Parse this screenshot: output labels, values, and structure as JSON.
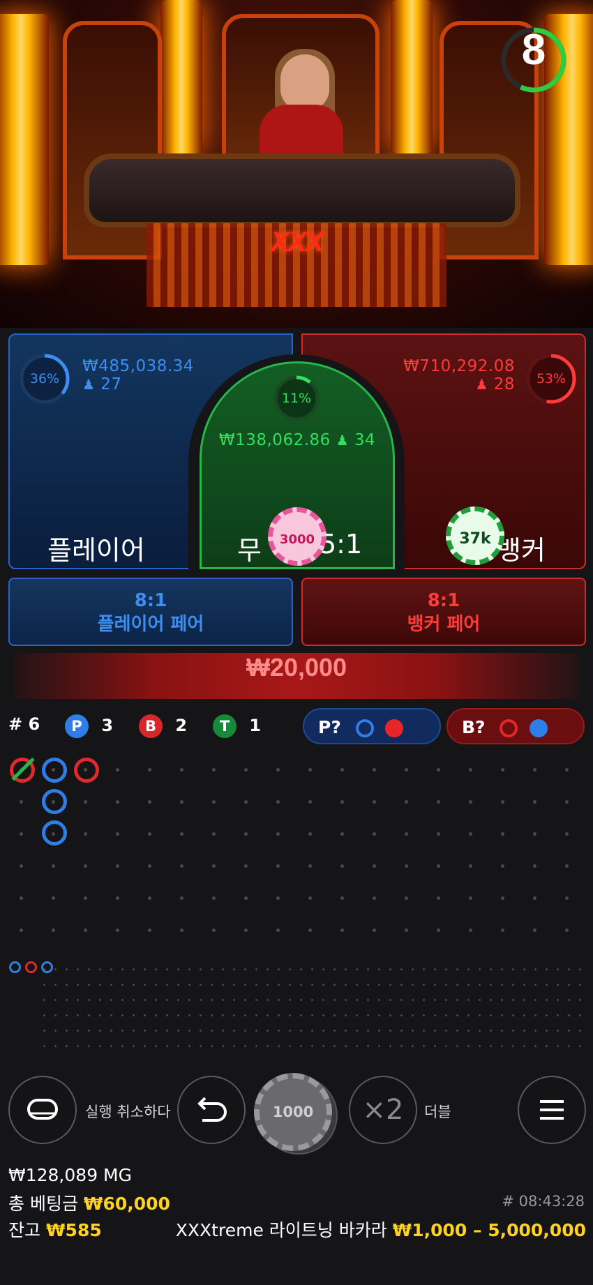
{
  "timer": {
    "seconds": "8",
    "remaining_fraction": 0.57,
    "color": "#2ecc40"
  },
  "video": {
    "logo_text": "XXX"
  },
  "player": {
    "percent": "36%",
    "percent_value": 0.36,
    "amount": "₩485,038.34",
    "bettors": "27",
    "label": "플레이어",
    "color": "#3d8ef0"
  },
  "banker": {
    "percent": "53%",
    "percent_value": 0.53,
    "amount": "₩710,292.08",
    "bettors": "28",
    "label": "뱅커",
    "color": "#ff3b3b"
  },
  "tie": {
    "percent": "11%",
    "percent_value": 0.11,
    "amount": "₩138,062.86",
    "bettors": "34",
    "label": "무",
    "payout": "5:1",
    "color": "#32e05a"
  },
  "chips_on_table": {
    "tie_chip": "3000",
    "banker_chip": "37k"
  },
  "player_pair": {
    "payout": "8:1",
    "label": "플레이어 페어"
  },
  "banker_pair": {
    "payout": "8:1",
    "label": "뱅커 페어"
  },
  "total_bet_display": "₩20,000",
  "road_stats": {
    "rounds_symbol": "#",
    "rounds": "6",
    "p_badge": "P",
    "p_count": "3",
    "b_badge": "B",
    "b_count": "2",
    "t_badge": "T",
    "t_count": "1"
  },
  "predictors": {
    "player": {
      "label": "P?"
    },
    "banker": {
      "label": "B?"
    }
  },
  "controls": {
    "undo_label": "실행 취소하다",
    "chip_value": "1000",
    "double_symbol": "×2",
    "double_label": "더블"
  },
  "footer": {
    "balance_mg": "₩128,089 MG",
    "total_bet_label": "총 베팅금",
    "total_bet_value": "₩60,000",
    "balance_label": "잔고",
    "balance_value": "₩585",
    "round_id": "# 08:43:28",
    "game_name": "XXXtreme 라이트닝 바카라",
    "limits": "₩1,000 – 5,000,000"
  }
}
